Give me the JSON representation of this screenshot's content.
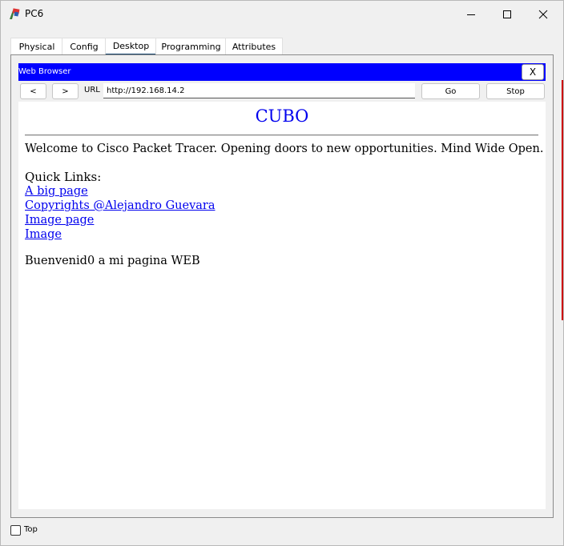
{
  "window": {
    "title": "PC6",
    "app_icon": "packet-tracer-pc-icon",
    "controls": [
      "minimize-icon",
      "maximize-icon",
      "close-icon"
    ]
  },
  "tabs": [
    {
      "label": "Physical",
      "active": false
    },
    {
      "label": "Config",
      "active": false
    },
    {
      "label": "Desktop",
      "active": true
    },
    {
      "label": "Programming",
      "active": false
    },
    {
      "label": "Attributes",
      "active": false
    }
  ],
  "browser": {
    "title": "Web Browser",
    "close_label": "X",
    "back_label": "<",
    "forward_label": ">",
    "url_label": "URL",
    "url_value": "http://192.168.14.2",
    "go_label": "Go",
    "stop_label": "Stop",
    "title_bar_color": "#0000ff"
  },
  "page": {
    "heading": "CUBO",
    "welcome": "Welcome to Cisco Packet Tracer. Opening doors to new opportunities. Mind Wide Open.",
    "quick_links_label": "Quick Links:",
    "links": [
      "A big page",
      "Copyrights @Alejandro Guevara",
      "Image page",
      "Image"
    ],
    "footer": "Buenvenid0 a mi pagina WEB",
    "link_color": "#0000ee"
  },
  "bottom": {
    "top_checkbox_label": "Top",
    "top_checked": false
  }
}
